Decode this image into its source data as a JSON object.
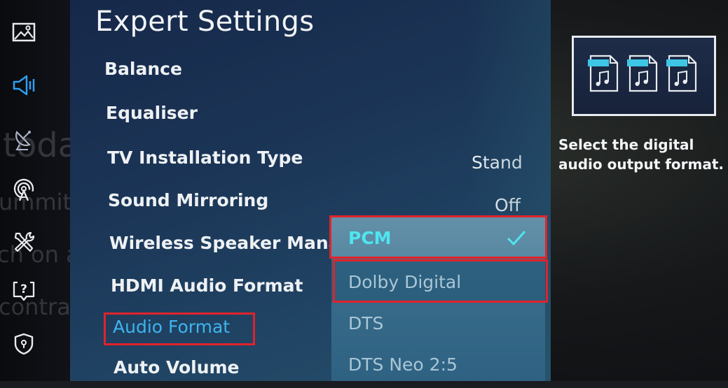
{
  "background_text": [
    "toda",
    "ummit",
    "ch on a",
    "contrac"
  ],
  "sidebar": {
    "items": [
      {
        "name": "picture",
        "icon": "picture-icon",
        "active": false
      },
      {
        "name": "sound",
        "icon": "speaker-icon",
        "active": true
      },
      {
        "name": "broadcasting",
        "icon": "satellite-dish-icon",
        "active": false
      },
      {
        "name": "network",
        "icon": "antenna-icon",
        "active": false
      },
      {
        "name": "general",
        "icon": "tools-icon",
        "active": false
      },
      {
        "name": "support",
        "icon": "help-icon",
        "active": false
      },
      {
        "name": "privacy",
        "icon": "shield-icon",
        "active": false
      }
    ]
  },
  "main": {
    "title": "Expert Settings",
    "menu": [
      {
        "label": "Balance",
        "value": ""
      },
      {
        "label": "Equaliser",
        "value": ""
      },
      {
        "label": "TV Installation Type",
        "value": "Stand"
      },
      {
        "label": "Sound Mirroring",
        "value": "Off"
      },
      {
        "label": "Wireless Speaker Manage",
        "value": ""
      },
      {
        "label": "HDMI Audio Format",
        "value": ""
      },
      {
        "label": "Audio Format",
        "value": "",
        "active": true
      },
      {
        "label": "Auto Volume",
        "value": ""
      }
    ]
  },
  "dropdown": {
    "options": [
      {
        "label": "PCM",
        "selected": true
      },
      {
        "label": "Dolby Digital",
        "focused": true
      },
      {
        "label": "DTS"
      },
      {
        "label": "DTS Neo 2:5"
      }
    ],
    "check_icon": "checkmark-icon"
  },
  "info": {
    "description": "Select the digital audio output format.",
    "preview_icons": [
      "audio-file-icon",
      "audio-file-icon",
      "audio-file-icon"
    ]
  },
  "colors": {
    "accent_blue": "#3fb4ee",
    "selected_cyan": "#4fe6ef",
    "annotation_red": "#e0232a"
  }
}
